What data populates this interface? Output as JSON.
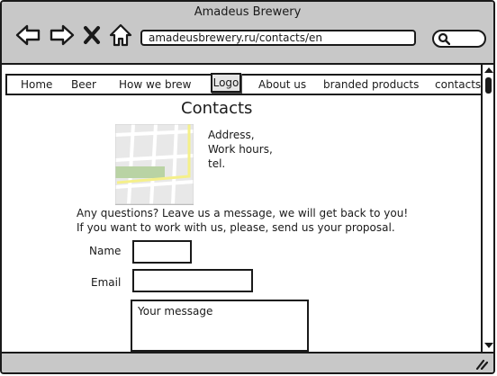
{
  "browser": {
    "title": "Amadeus Brewery",
    "url": "amadeusbrewery.ru/contacts/en",
    "icons": [
      "back-arrow-icon",
      "forward-arrow-icon",
      "close-icon",
      "home-icon",
      "search-icon"
    ]
  },
  "nav": {
    "items": [
      "Home",
      "Beer",
      "How we brew",
      "About us",
      "branded products",
      "contacts"
    ],
    "logo": "Logo"
  },
  "page": {
    "title": "Contacts",
    "contact_lines": [
      "Address,",
      "Work hours,",
      "tel."
    ],
    "intro_lines": [
      "Any questions? Leave us a message, we will get back to you!",
      "If you want to work with us, please, send us your proposal."
    ]
  },
  "form": {
    "name_label": "Name",
    "email_label": "Email",
    "message_placeholder": "Your message"
  },
  "colors": {
    "chrome_gray": "#c8c8c8",
    "ink": "#1a1a1a",
    "map_green": "#b9d3a4",
    "map_road_yellow": "#f5f08a"
  }
}
